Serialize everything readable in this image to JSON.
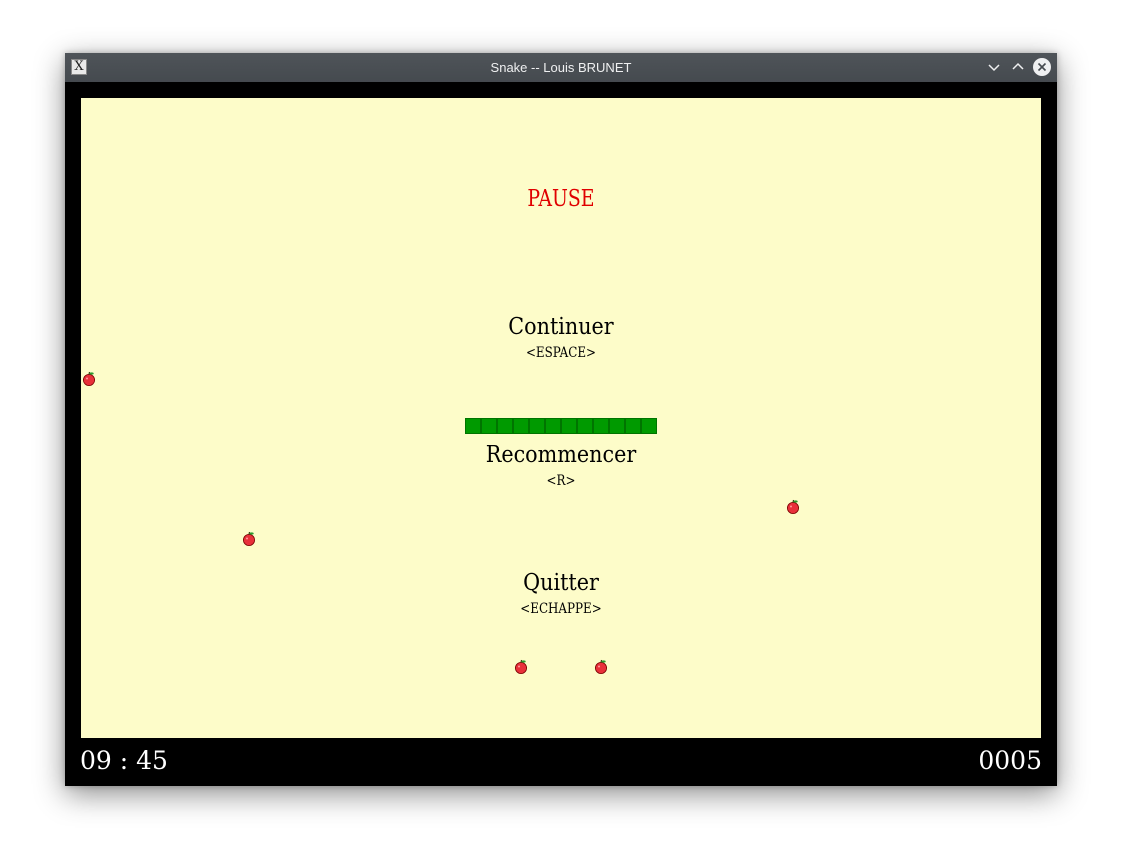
{
  "window": {
    "title": "Snake -- Louis BRUNET",
    "app_icon_glyph": "X"
  },
  "game": {
    "pause_title": "PAUSE",
    "menu": [
      {
        "label": "Continuer",
        "key": "<ESPACE>"
      },
      {
        "label": "Recommencer",
        "key": "<R>"
      },
      {
        "label": "Quitter",
        "key": "<ECHAPPE>"
      }
    ],
    "snake_segments": 12,
    "apples_count": 5
  },
  "status": {
    "time": "09 : 45",
    "score": "0005"
  },
  "colors": {
    "board": "#fdfcc9",
    "pause_text": "#e00000",
    "snake": "#009a00",
    "apple": "#e8303a"
  }
}
